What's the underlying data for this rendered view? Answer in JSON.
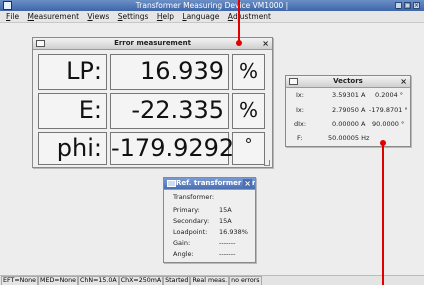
{
  "window": {
    "title": "Transformer Measuring Device  VM1000 |"
  },
  "menu": [
    {
      "u": "F",
      "rest": "ile"
    },
    {
      "u": "M",
      "rest": "easurement"
    },
    {
      "u": "V",
      "rest": "iews"
    },
    {
      "u": "S",
      "rest": "ettings"
    },
    {
      "u": "H",
      "rest": "elp"
    },
    {
      "u": "L",
      "rest": "anguage"
    },
    {
      "u": "A",
      "rest": "djustment"
    }
  ],
  "error_window": {
    "title": "Error measurement",
    "rows": [
      {
        "label": "LP:",
        "value": "16.939",
        "unit": "%"
      },
      {
        "label": "E:",
        "value": "-22.335",
        "unit": "%"
      },
      {
        "label": "phi:",
        "value": "-179.9292",
        "unit": "°"
      }
    ]
  },
  "vectors_window": {
    "title": "Vectors",
    "rows": [
      {
        "label": "Ix:",
        "v1": "3.59301 A",
        "v2": "0.2004 °"
      },
      {
        "label": "Ix:",
        "v1": "2.79050 A",
        "v2": "-179.8701 °"
      },
      {
        "label": "dIx:",
        "v1": "0.00000 A",
        "v2": "90.0000 °"
      },
      {
        "label": "F:",
        "v1": "50.00005 Hz",
        "v2": ""
      }
    ]
  },
  "ref_window": {
    "title": "Ref. transformer err",
    "heading": "Transformer:",
    "rows": [
      {
        "label": "Primary:",
        "value": "15A"
      },
      {
        "label": "Secondary:",
        "value": "15A"
      },
      {
        "label": "Loadpoint:",
        "value": "16.938%"
      },
      {
        "label": "Gain:",
        "value": "-------"
      },
      {
        "label": "Angle:",
        "value": "-------"
      }
    ]
  },
  "status": [
    "EFT=None",
    "MED=None",
    "ChN=15.0A",
    "ChX=250mA",
    "Started",
    "Real meas.",
    "no errors"
  ],
  "colors": {
    "title_bar": "#3e66a8",
    "annotation_line": "#e00000"
  }
}
